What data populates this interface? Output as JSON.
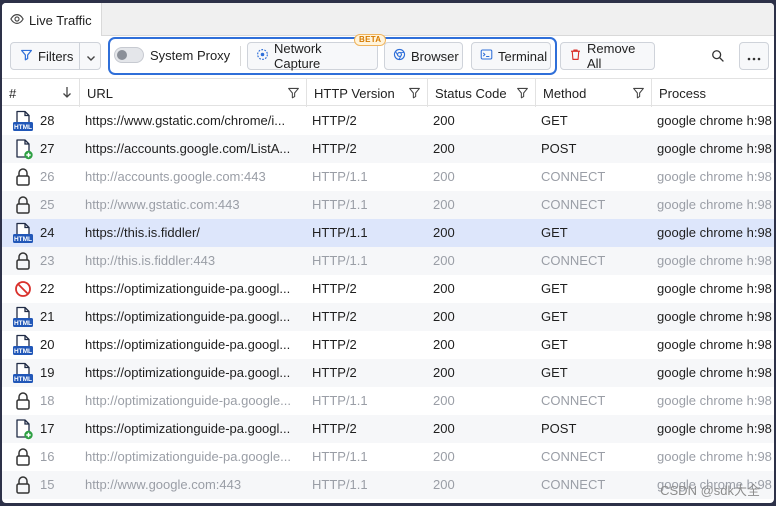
{
  "tab": {
    "label": "Live Traffic"
  },
  "toolbar": {
    "filters_label": "Filters",
    "system_proxy_label": "System Proxy",
    "network_capture_label": "Network Capture",
    "beta_label": "BETA",
    "browser_label": "Browser",
    "terminal_label": "Terminal",
    "remove_all_label": "Remove All"
  },
  "columns": {
    "num": "#",
    "url": "URL",
    "version": "HTTP Version",
    "status": "Status Code",
    "method": "Method",
    "process": "Process"
  },
  "rows": [
    {
      "icon": "html-document-icon",
      "num": "28",
      "url": "https://www.gstatic.com/chrome/i...",
      "version": "HTTP/2",
      "status": "200",
      "method": "GET",
      "process": "google chrome h:98"
    },
    {
      "icon": "document-add-icon",
      "num": "27",
      "url": "https://accounts.google.com/ListA...",
      "version": "HTTP/2",
      "status": "200",
      "method": "POST",
      "process": "google chrome h:98"
    },
    {
      "icon": "lock-icon",
      "num": "26",
      "url": "http://accounts.google.com:443",
      "version": "HTTP/1.1",
      "status": "200",
      "method": "CONNECT",
      "process": "google chrome h:98"
    },
    {
      "icon": "lock-icon",
      "num": "25",
      "url": "http://www.gstatic.com:443",
      "version": "HTTP/1.1",
      "status": "200",
      "method": "CONNECT",
      "process": "google chrome h:98"
    },
    {
      "icon": "html-document-icon",
      "num": "24",
      "url": "https://this.is.fiddler/",
      "version": "HTTP/1.1",
      "status": "200",
      "method": "GET",
      "process": "google chrome h:98"
    },
    {
      "icon": "lock-icon",
      "num": "23",
      "url": "http://this.is.fiddler:443",
      "version": "HTTP/1.1",
      "status": "200",
      "method": "CONNECT",
      "process": "google chrome h:98"
    },
    {
      "icon": "blocked-icon",
      "num": "22",
      "url": "https://optimizationguide-pa.googl...",
      "version": "HTTP/2",
      "status": "200",
      "method": "GET",
      "process": "google chrome h:98"
    },
    {
      "icon": "html-document-icon",
      "num": "21",
      "url": "https://optimizationguide-pa.googl...",
      "version": "HTTP/2",
      "status": "200",
      "method": "GET",
      "process": "google chrome h:98"
    },
    {
      "icon": "html-document-icon",
      "num": "20",
      "url": "https://optimizationguide-pa.googl...",
      "version": "HTTP/2",
      "status": "200",
      "method": "GET",
      "process": "google chrome h:98"
    },
    {
      "icon": "html-document-icon",
      "num": "19",
      "url": "https://optimizationguide-pa.googl...",
      "version": "HTTP/2",
      "status": "200",
      "method": "GET",
      "process": "google chrome h:98"
    },
    {
      "icon": "lock-icon",
      "num": "18",
      "url": "http://optimizationguide-pa.google...",
      "version": "HTTP/1.1",
      "status": "200",
      "method": "CONNECT",
      "process": "google chrome h:98"
    },
    {
      "icon": "document-add-icon",
      "num": "17",
      "url": "https://optimizationguide-pa.googl...",
      "version": "HTTP/2",
      "status": "200",
      "method": "POST",
      "process": "google chrome h:98"
    },
    {
      "icon": "lock-icon",
      "num": "16",
      "url": "http://optimizationguide-pa.google...",
      "version": "HTTP/1.1",
      "status": "200",
      "method": "CONNECT",
      "process": "google chrome h:98"
    },
    {
      "icon": "lock-icon",
      "num": "15",
      "url": "http://www.google.com:443",
      "version": "HTTP/1.1",
      "status": "200",
      "method": "CONNECT",
      "process": "google chrome h:98"
    }
  ],
  "watermark": "CSDN @sdk大全",
  "colors": {
    "accent": "#2f6fd9",
    "selected_row": "#dde6fb",
    "danger": "#d9302b",
    "muted_text": "#9a9ea6"
  }
}
